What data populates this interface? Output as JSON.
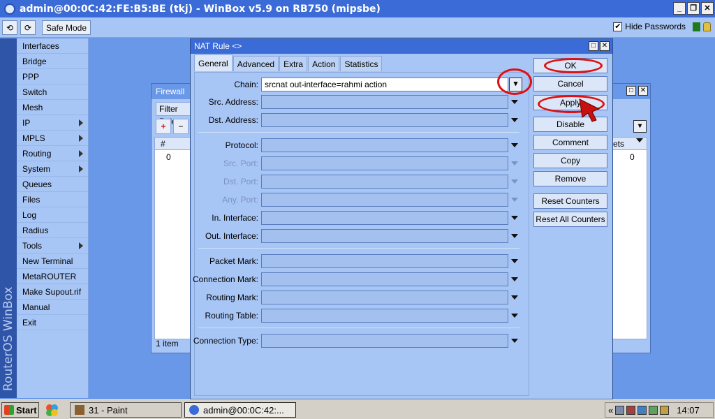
{
  "window": {
    "title": "admin@00:0C:42:FE:B5:BE (tkj) - WinBox v5.9 on RB750 (mipsbe)",
    "min": "_",
    "max": "❐",
    "close": "✕"
  },
  "toolbar": {
    "undo": "⟲",
    "redo": "⟳",
    "safe_mode": "Safe Mode",
    "hide_passwords_label": "Hide Passwords",
    "hide_passwords_checked": "✔"
  },
  "sidebar": {
    "brand": "RouterOS WinBox",
    "items": [
      {
        "label": "Interfaces"
      },
      {
        "label": "Bridge"
      },
      {
        "label": "PPP"
      },
      {
        "label": "Switch"
      },
      {
        "label": "Mesh"
      },
      {
        "label": "IP"
      },
      {
        "label": "MPLS"
      },
      {
        "label": "Routing"
      },
      {
        "label": "System"
      },
      {
        "label": "Queues"
      },
      {
        "label": "Files"
      },
      {
        "label": "Log"
      },
      {
        "label": "Radius"
      },
      {
        "label": "Tools"
      },
      {
        "label": "New Terminal"
      },
      {
        "label": "MetaROUTER"
      },
      {
        "label": "Make Supout.rif"
      },
      {
        "label": "Manual"
      },
      {
        "label": "Exit"
      }
    ]
  },
  "firewall": {
    "title": "Firewall",
    "tab": "Filter Rule",
    "add": "+",
    "remove": "−",
    "col_num": "#",
    "row_num": "0",
    "col_right": "ets",
    "row_right": "0",
    "status": "1 item"
  },
  "nat": {
    "title": "NAT Rule <>",
    "tabs": [
      "General",
      "Advanced",
      "Extra",
      "Action",
      "Statistics"
    ],
    "fields": {
      "chain_label": "Chain:",
      "chain_value": "srcnat out-interface=rahmi action",
      "src_address": "Src. Address:",
      "dst_address": "Dst. Address:",
      "protocol": "Protocol:",
      "src_port": "Src. Port:",
      "dst_port": "Dst. Port:",
      "any_port": "Any. Port:",
      "in_interface": "In. Interface:",
      "out_interface": "Out. Interface:",
      "packet_mark": "Packet Mark:",
      "connection_mark": "Connection Mark:",
      "routing_mark": "Routing Mark:",
      "routing_table": "Routing Table:",
      "connection_type": "Connection Type:"
    },
    "buttons": {
      "ok": "OK",
      "cancel": "Cancel",
      "apply": "Apply",
      "disable": "Disable",
      "comment": "Comment",
      "copy": "Copy",
      "remove": "Remove",
      "reset_counters": "Reset Counters",
      "reset_all_counters": "Reset All Counters"
    }
  },
  "taskbar": {
    "start": "Start",
    "task_paint": "31 - Paint",
    "task_winbox": "admin@00:0C:42:...",
    "tray_chevron": "«",
    "clock": "14:07"
  },
  "colors": {
    "desktop": "#6a98e8",
    "panel": "#a7c5f5",
    "title_bar": "#3b6bd6",
    "annotation": "#e01010"
  }
}
